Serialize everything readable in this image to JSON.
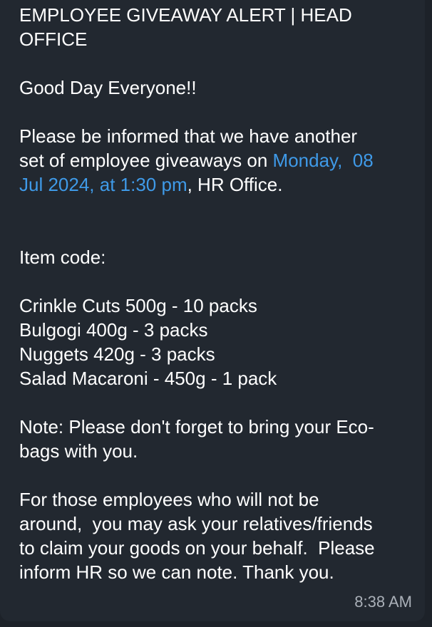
{
  "message": {
    "title_line1": "EMPLOYEE GIVEAWAY ALERT | HEAD",
    "title_line2": "OFFICE",
    "greeting": "Good Day Everyone!!",
    "info_line1": "Please be informed that we have another",
    "info_line2_text": "set of employee giveaways on ",
    "info_line2_link": "Monday,  08",
    "info_line3_link": "Jul 2024, at 1:30 pm",
    "info_line3_text": ", HR Office.",
    "item_code_label": "Item code:",
    "items": [
      "Crinkle Cuts 500g - 10 packs",
      "Bulgogi 400g - 3 packs",
      "Nuggets 420g - 3 packs",
      "Salad Macaroni - 450g - 1 pack"
    ],
    "note_line1": "Note: Please don't forget to bring your Eco-",
    "note_line2": "bags with you.",
    "closing_lines": [
      "For those employees who will not be",
      "around,  you may ask your relatives/friends",
      "to claim your goods on your behalf.  Please",
      "inform HR so we can note. Thank you."
    ],
    "timestamp": "8:38 AM"
  },
  "colors": {
    "background": "#1d2229",
    "bubble": "#222830",
    "text": "#ffffff",
    "link": "#3f9ae8",
    "timestamp": "#aab0b8"
  }
}
